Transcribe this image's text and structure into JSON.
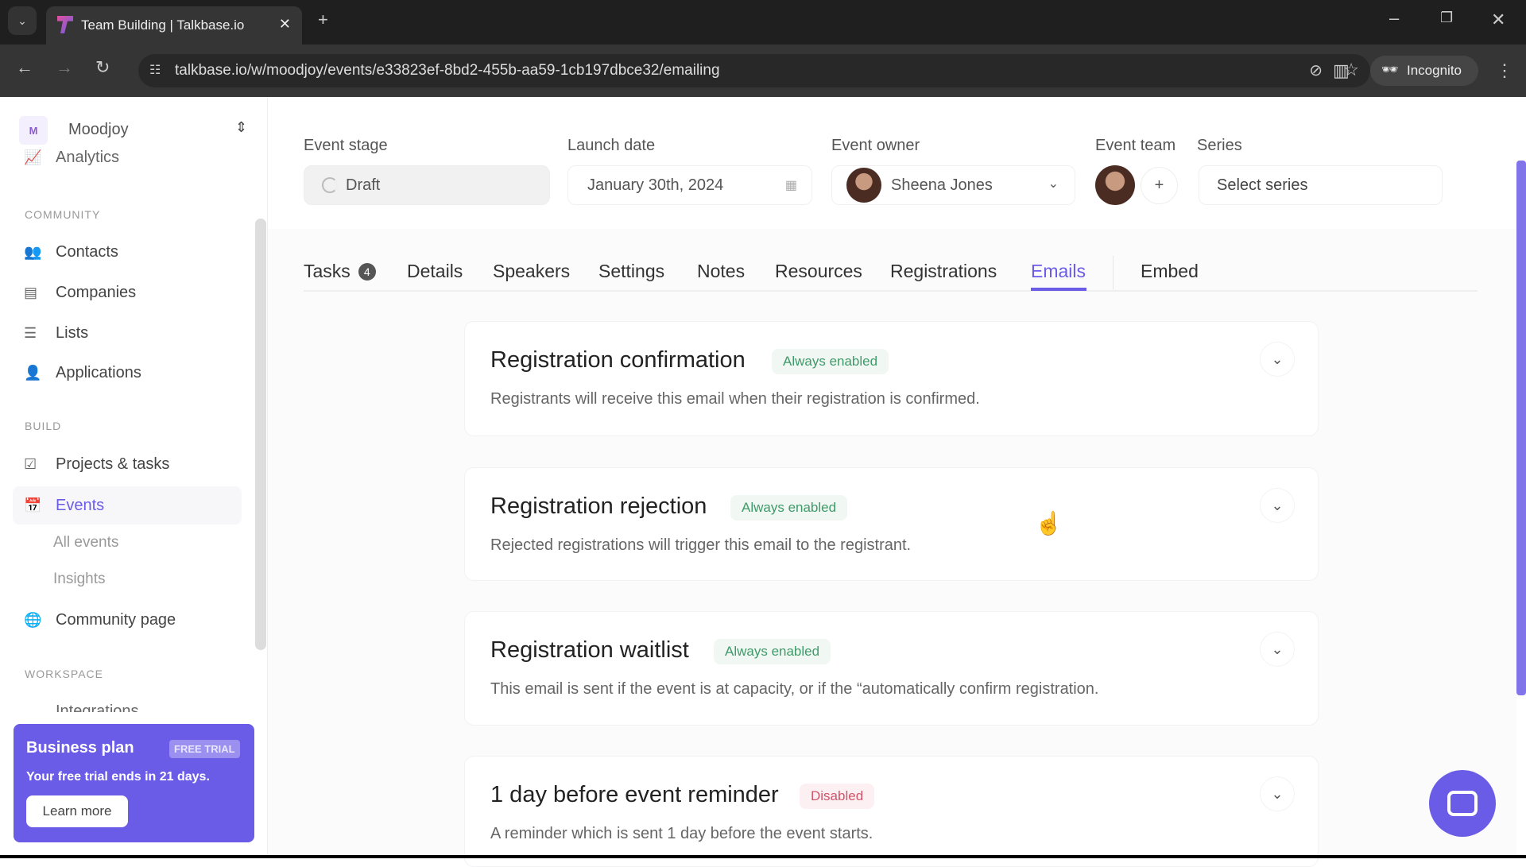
{
  "browser": {
    "tab_title": "Team Building | Talkbase.io",
    "url": "talkbase.io/w/moodjoy/events/e33823ef-8bd2-455b-aa59-1cb197dbce32/emailing",
    "incognito_label": "Incognito"
  },
  "sidebar": {
    "workspace_initial": "M",
    "workspace_name": "Moodjoy",
    "analytics": "Analytics",
    "community_header": "COMMUNITY",
    "community_items": [
      "Contacts",
      "Companies",
      "Lists",
      "Applications"
    ],
    "build_header": "BUILD",
    "projects": "Projects & tasks",
    "events": "Events",
    "events_sub": [
      "All events",
      "Insights"
    ],
    "community_page": "Community page",
    "workspace_header": "WORKSPACE",
    "integrations": "Integrations",
    "plan": {
      "title": "Business plan",
      "badge": "FREE TRIAL",
      "text": "Your free trial ends in 21 days.",
      "button": "Learn more"
    }
  },
  "fields": {
    "stage_label": "Event stage",
    "stage_value": "Draft",
    "launch_label": "Launch date",
    "launch_value": "January 30th, 2024",
    "owner_label": "Event owner",
    "owner_value": "Sheena Jones",
    "team_label": "Event team",
    "team_add": "+",
    "series_label": "Series",
    "series_placeholder": "Select series"
  },
  "tabs": {
    "tasks": "Tasks",
    "tasks_count": "4",
    "items": [
      "Details",
      "Speakers",
      "Settings",
      "Notes",
      "Resources",
      "Registrations",
      "Emails"
    ],
    "active": "Emails",
    "embed": "Embed"
  },
  "emails": [
    {
      "title": "Registration confirmation",
      "status": "Always enabled",
      "desc": "Registrants will receive this email when their registration is confirmed."
    },
    {
      "title": "Registration rejection",
      "status": "Always enabled",
      "desc": "Rejected registrations will trigger this email to the registrant."
    },
    {
      "title": "Registration waitlist",
      "status": "Always enabled",
      "desc": "This email is sent if the event is at capacity, or if the “automatically confirm registration."
    },
    {
      "title": "1 day before event reminder",
      "status": "Disabled",
      "desc": "A reminder which is sent 1 day before the event starts."
    }
  ],
  "colors": {
    "accent": "#6b5ce7",
    "enabled_text": "#3f9a6a",
    "enabled_bg": "#f1f8f3",
    "disabled_text": "#d0556a",
    "disabled_bg": "#fdf0f2"
  }
}
